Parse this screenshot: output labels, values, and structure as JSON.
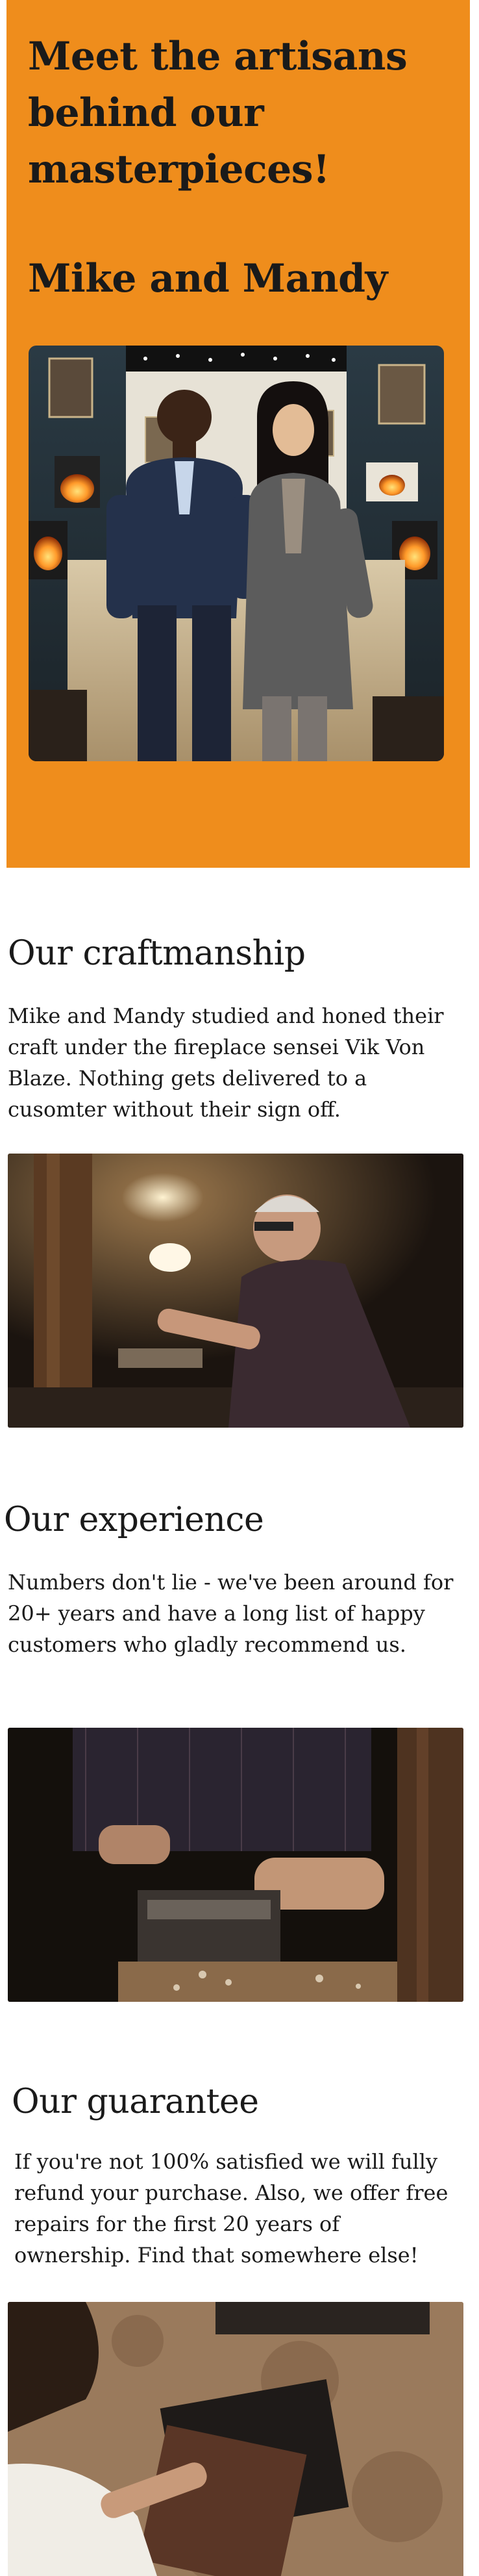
{
  "hero": {
    "title": "Meet the artisans behind our masterpieces!",
    "names": "Mike and Mandy",
    "background_color": "#ef8d1c"
  },
  "sections": [
    {
      "title": "Our craftmanship",
      "text": "Mike and Mandy studied and honed their craft under the fireplace sensei Vik Von Blaze. Nothing gets delivered to a cusomter without their sign off."
    },
    {
      "title": "Our experience",
      "text": "Numbers don't lie - we've been around for 20+ years and have a long list of happy customers who gladly recommend us."
    },
    {
      "title": "Our guarantee",
      "text": "If you're not 100% satisfied we will fully refund your purchase. Also, we offer free repairs for the first 20 years of ownership. Find that somewhere else!"
    }
  ]
}
